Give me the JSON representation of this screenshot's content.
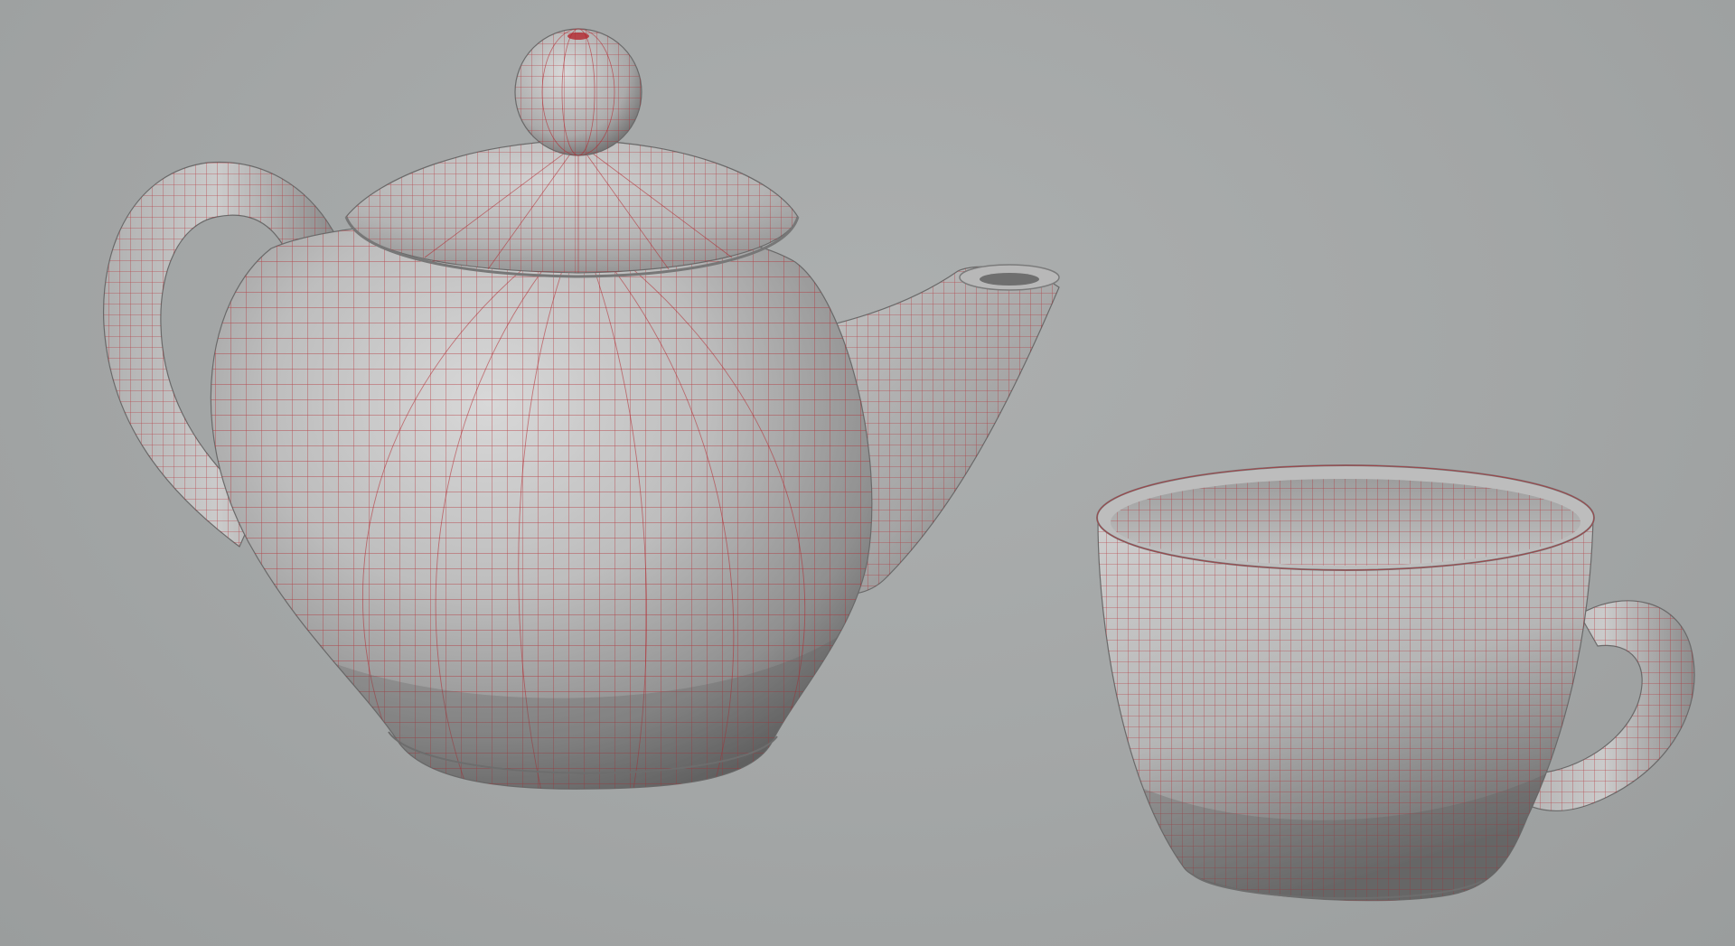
{
  "scene": {
    "background_color": "#a3a6a6",
    "surface_color": "#c9c9c9",
    "shadow_color": "#5e5e5e",
    "wire_color": "#b3262d",
    "objects": [
      "teapot",
      "teacup"
    ]
  }
}
